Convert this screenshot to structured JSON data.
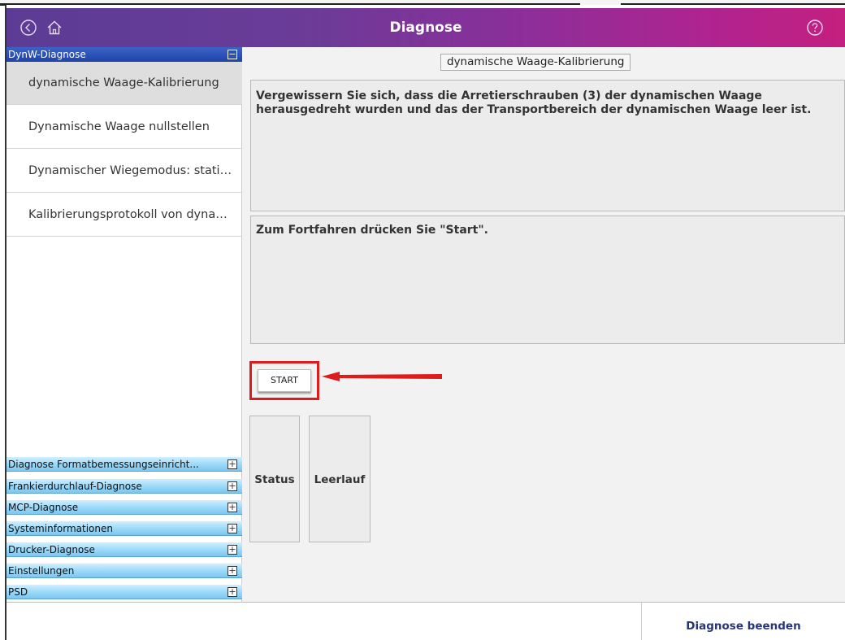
{
  "header": {
    "title": "Diagnose",
    "icons": [
      "back-icon",
      "home-icon",
      "help-icon"
    ]
  },
  "sidebar": {
    "active_section": {
      "label": "DynW-Diagnose",
      "toggle": "−",
      "items": [
        {
          "label": "dynamische Waage-Kalibrierung",
          "selected": true
        },
        {
          "label": "Dynamische Waage nullstellen",
          "selected": false
        },
        {
          "label": "Dynamischer Wiegemodus: statis...",
          "selected": false
        },
        {
          "label": "Kalibrierungsprotokoll von dynami...",
          "selected": false
        }
      ]
    },
    "sections": [
      {
        "label": "Diagnose Formatbemessungseinricht...",
        "toggle": "+"
      },
      {
        "label": "Frankierdurchlauf-Diagnose",
        "toggle": "+"
      },
      {
        "label": "MCP-Diagnose",
        "toggle": "+"
      },
      {
        "label": "Systeminformationen",
        "toggle": "+"
      },
      {
        "label": "Drucker-Diagnose",
        "toggle": "+"
      },
      {
        "label": "Einstellungen",
        "toggle": "+"
      },
      {
        "label": "PSD",
        "toggle": "+"
      }
    ]
  },
  "main": {
    "title": "dynamische Waage-Kalibrierung",
    "instruction": "Vergewissern Sie sich, dass die Arretierschrauben (3) der dynamischen Waage herausgedreht wurden und das der Transportbereich der dynamischen Waage leer ist.",
    "prompt": "Zum Fortfahren drücken Sie \"Start\".",
    "start_label": "START",
    "status_label": "Status",
    "status_value": "Leerlauf"
  },
  "footer": {
    "exit_label": "Diagnose beenden"
  },
  "colors": {
    "header_gradient_start": "#5b3c95",
    "header_gradient_end": "#c4207f",
    "highlight_red": "#e01b1b",
    "active_section": "#2b4fb4",
    "closed_section": "#9ad8f8",
    "exit_text": "#26357a"
  }
}
